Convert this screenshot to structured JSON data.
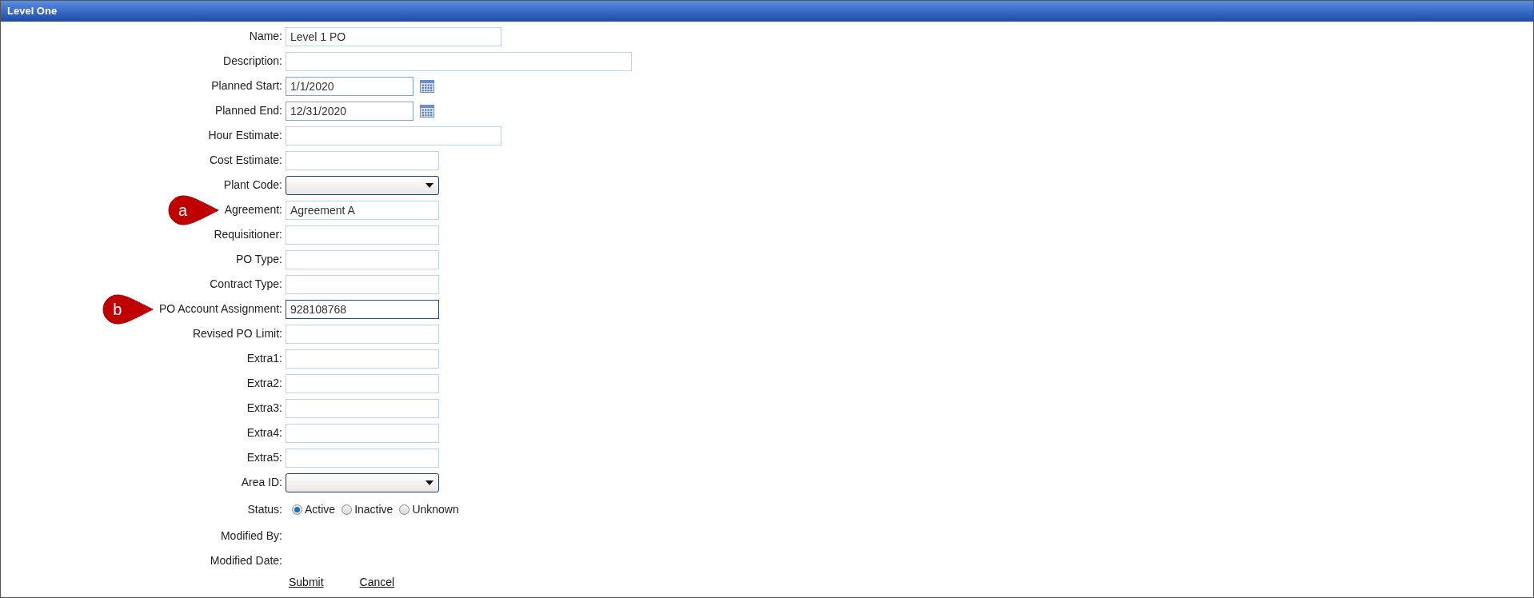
{
  "window": {
    "title": "Level One"
  },
  "fields": [
    {
      "label": "Name:",
      "kind": "long-text",
      "value": "Level 1 PO",
      "focused": false
    },
    {
      "label": "Description:",
      "kind": "wide-text",
      "focused": false
    },
    {
      "label": "Planned Start:",
      "kind": "date",
      "value": "1/1/2020",
      "focused": false
    },
    {
      "label": "Planned End:",
      "kind": "date",
      "value": "12/31/2020",
      "focused": false
    },
    {
      "label": "Hour Estimate:",
      "kind": "long-text",
      "focused": false
    },
    {
      "label": "Cost Estimate:",
      "kind": "text",
      "focused": false
    },
    {
      "label": "Plant Code:",
      "kind": "select"
    },
    {
      "label": "Agreement:",
      "kind": "text",
      "value": "Agreement A",
      "focused": false,
      "callout": "a"
    },
    {
      "label": "Requisitioner:",
      "kind": "text",
      "focused": false
    },
    {
      "label": "PO Type:",
      "kind": "text",
      "focused": false
    },
    {
      "label": "Contract Type:",
      "kind": "text",
      "focused": false
    },
    {
      "label": "PO Account Assignment:",
      "kind": "text",
      "value": "928108768",
      "focused": true,
      "callout": "b"
    },
    {
      "label": "Revised PO Limit:",
      "kind": "text",
      "focused": false
    },
    {
      "label": "Extra1:",
      "kind": "text",
      "focused": false
    },
    {
      "label": "Extra2:",
      "kind": "text",
      "focused": false
    },
    {
      "label": "Extra3:",
      "kind": "text",
      "focused": false
    },
    {
      "label": "Extra4:",
      "kind": "text",
      "focused": false
    },
    {
      "label": "Extra5:",
      "kind": "text",
      "focused": false
    },
    {
      "label": "Area ID:",
      "kind": "select"
    }
  ],
  "status": {
    "label": "Status:",
    "options": [
      {
        "label": "Active",
        "selected": true
      },
      {
        "label": "Inactive",
        "selected": false
      },
      {
        "label": "Unknown",
        "selected": false
      }
    ]
  },
  "info": [
    {
      "label": "Modified By:"
    },
    {
      "label": "Modified Date:"
    }
  ],
  "actions": [
    {
      "label": "Submit"
    },
    {
      "label": "Cancel"
    }
  ]
}
